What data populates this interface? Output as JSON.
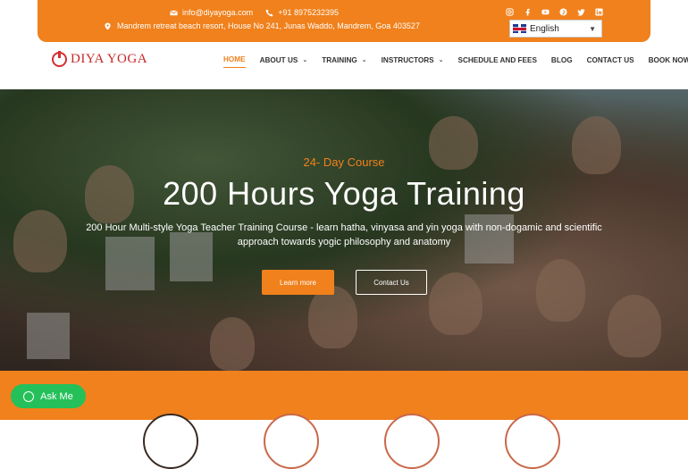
{
  "topbar": {
    "email": "info@diyayoga.com",
    "phone": "+91 8975232395",
    "address": "Mandrem retreat beach resort, House No 241, Junas Waddo, Mandrem, Goa 403527",
    "social_icons": [
      "instagram-icon",
      "facebook-icon",
      "youtube-icon",
      "pinterest-icon",
      "twitter-icon",
      "linkedin-icon"
    ],
    "language": "English"
  },
  "nav": {
    "logo_text": "DIYA YOGA",
    "items": [
      {
        "label": "HOME",
        "active": true,
        "dropdown": false
      },
      {
        "label": "ABOUT US",
        "active": false,
        "dropdown": true
      },
      {
        "label": "TRAINING",
        "active": false,
        "dropdown": true
      },
      {
        "label": "INSTRUCTORS",
        "active": false,
        "dropdown": true
      },
      {
        "label": "SCHEDULE AND FEES",
        "active": false,
        "dropdown": false
      },
      {
        "label": "BLOG",
        "active": false,
        "dropdown": false
      },
      {
        "label": "CONTACT US",
        "active": false,
        "dropdown": false
      },
      {
        "label": "BOOK NOW",
        "active": false,
        "dropdown": false
      }
    ]
  },
  "hero": {
    "subtitle": "24- Day Course",
    "title": "200 Hours Yoga Training",
    "description": "200 Hour Multi-style Yoga Teacher Training Course - learn hatha, vinyasa and yin yoga with non-dogamic and scientific approach towards yogic philosophy and anatomy",
    "learn_more": "Learn more",
    "contact_us": "Contact Us"
  },
  "chat": {
    "label": "Ask Me"
  },
  "colors": {
    "accent": "#f0811c",
    "logo": "#c62828",
    "chat": "#25c05a"
  }
}
